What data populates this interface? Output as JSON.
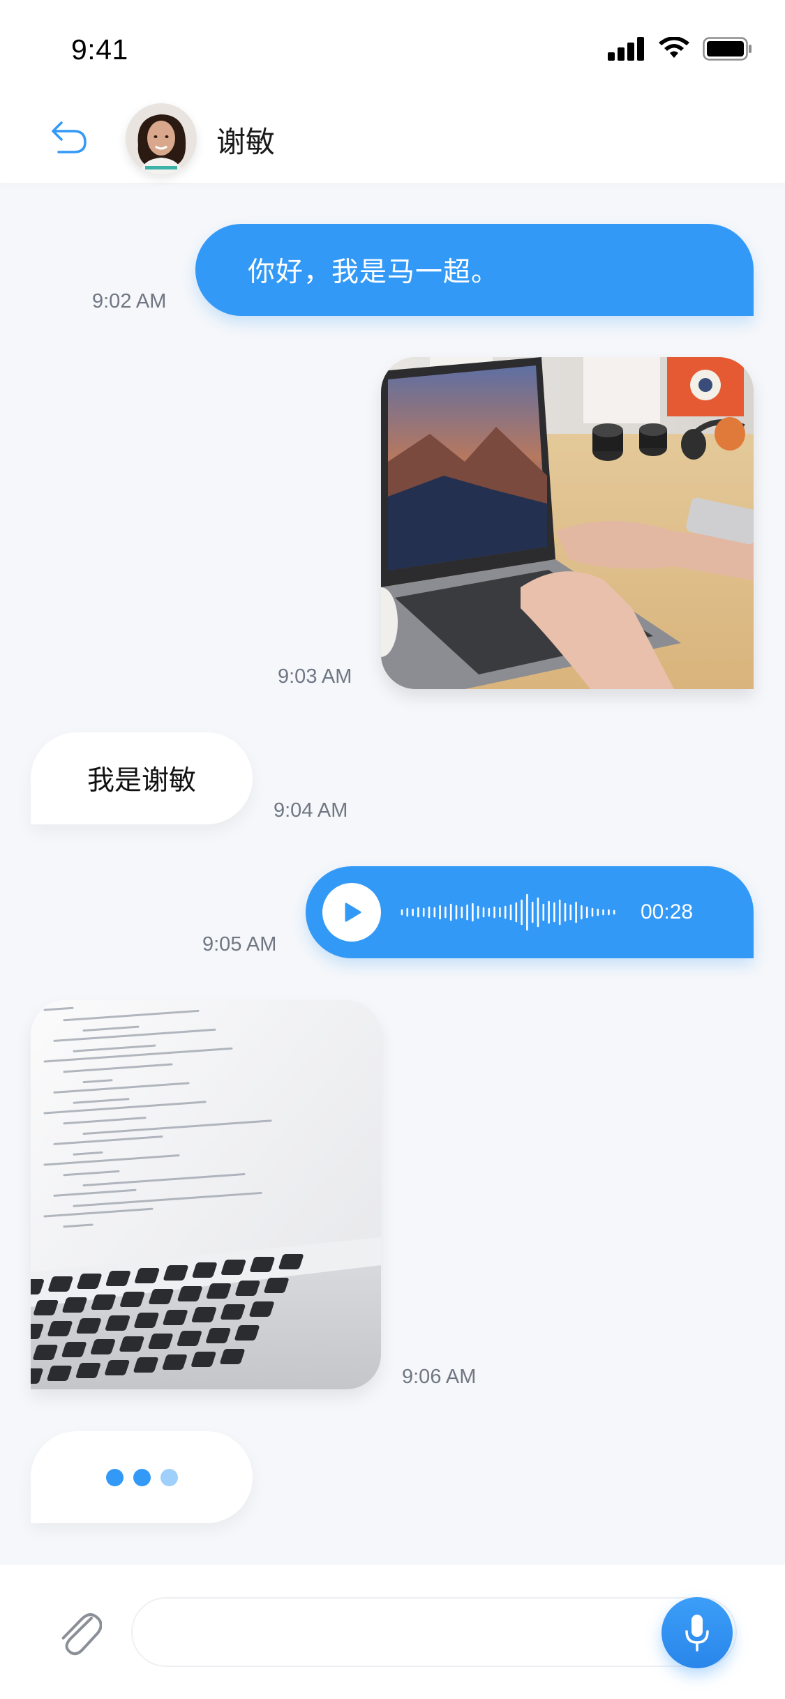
{
  "status_bar": {
    "time": "9:41"
  },
  "header": {
    "contact_name": "谢敏",
    "back_icon": "back-arrow-icon"
  },
  "messages": [
    {
      "type": "text",
      "direction": "outgoing",
      "text": "你好，我是马一超。",
      "time": "9:02 AM"
    },
    {
      "type": "image",
      "direction": "outgoing",
      "description_icon": "laptop-photo",
      "time": "9:03 AM"
    },
    {
      "type": "text",
      "direction": "incoming",
      "text": "我是谢敏",
      "time": "9:04 AM"
    },
    {
      "type": "voice",
      "direction": "outgoing",
      "duration": "00:28",
      "time": "9:05 AM"
    },
    {
      "type": "image",
      "direction": "incoming",
      "description_icon": "code-laptop-photo",
      "time": "9:06 AM"
    },
    {
      "type": "typing",
      "direction": "incoming"
    }
  ],
  "composer": {
    "input_value": "",
    "input_placeholder": ""
  },
  "colors": {
    "accent": "#3399f7",
    "background": "#f5f7fa",
    "typing_dot_1": "#3399f7",
    "typing_dot_2": "#3399f7",
    "typing_dot_3": "#9fd0fb"
  }
}
